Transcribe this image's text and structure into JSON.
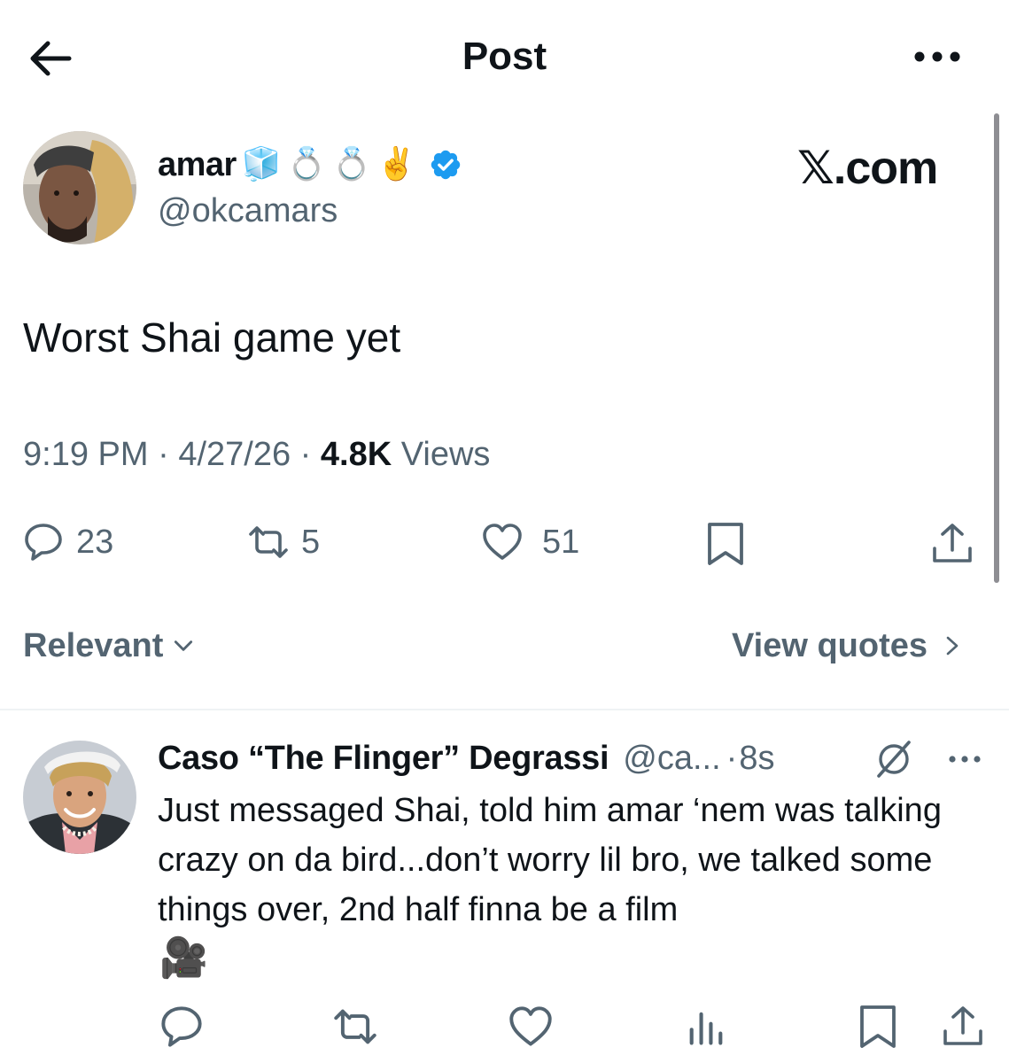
{
  "header": {
    "title": "Post",
    "back_icon": "arrow-left-icon",
    "more_icon": "more-horizontal-icon"
  },
  "post": {
    "display_name": "amar",
    "name_emojis": [
      "🧊",
      "💍",
      "💍",
      "✌️"
    ],
    "verified": true,
    "handle": "@okcamars",
    "brand": "𝕏.com",
    "text": "Worst Shai game yet",
    "time": "9:19 PM",
    "date": "4/27/26",
    "views_count": "4.8K",
    "views_label": "Views",
    "separator": "·",
    "actions": {
      "replies": "23",
      "reposts": "5",
      "likes": "51"
    }
  },
  "sort": {
    "label": "Relevant",
    "view_quotes": "View quotes"
  },
  "reply": {
    "display_name": "Caso “The Flinger” Degrassi",
    "handle": "@ca...",
    "separator": "·",
    "time": "8s",
    "text": "Just messaged Shai, told him amar ‘nem was talking crazy on da bird...don’t worry lil bro, we talked some things over, 2nd half finna be a film",
    "trailing_emoji": "🎥"
  },
  "colors": {
    "text": "#0f1419",
    "secondary": "#536471",
    "verified_blue": "#1d9bf0",
    "divider": "#eff3f4"
  }
}
